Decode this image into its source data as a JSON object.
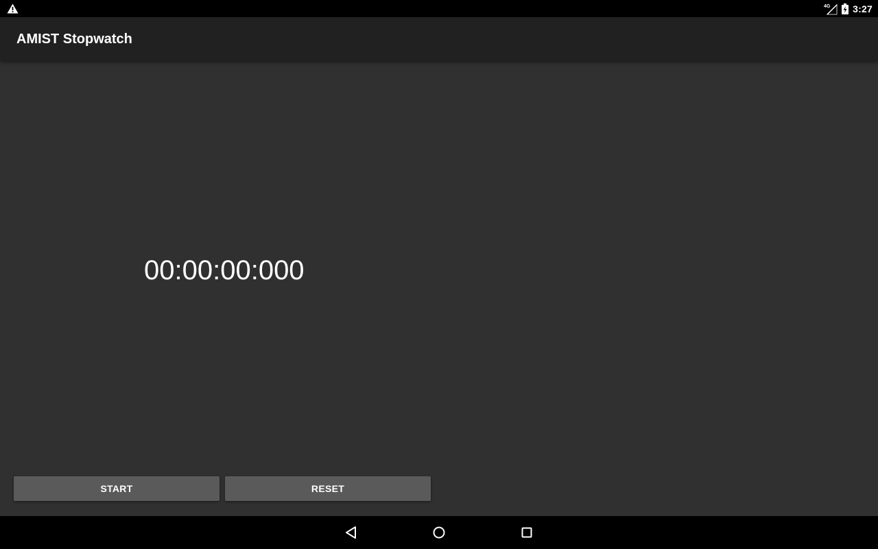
{
  "status_bar": {
    "time": "3:27",
    "network_label": "4G",
    "icons": [
      "warning-icon",
      "cell-signal-icon",
      "battery-charging-icon"
    ]
  },
  "app_bar": {
    "title": "AMIST Stopwatch"
  },
  "stopwatch": {
    "display": "00:00:00:000"
  },
  "buttons": {
    "start_label": "START",
    "reset_label": "RESET"
  },
  "nav_bar": {
    "icons": [
      "back-icon",
      "home-icon",
      "recents-icon"
    ]
  },
  "colors": {
    "status_bar": "#000000",
    "app_bar": "#212121",
    "background": "#303030",
    "button": "#5a5a5a",
    "text": "#ffffff"
  }
}
